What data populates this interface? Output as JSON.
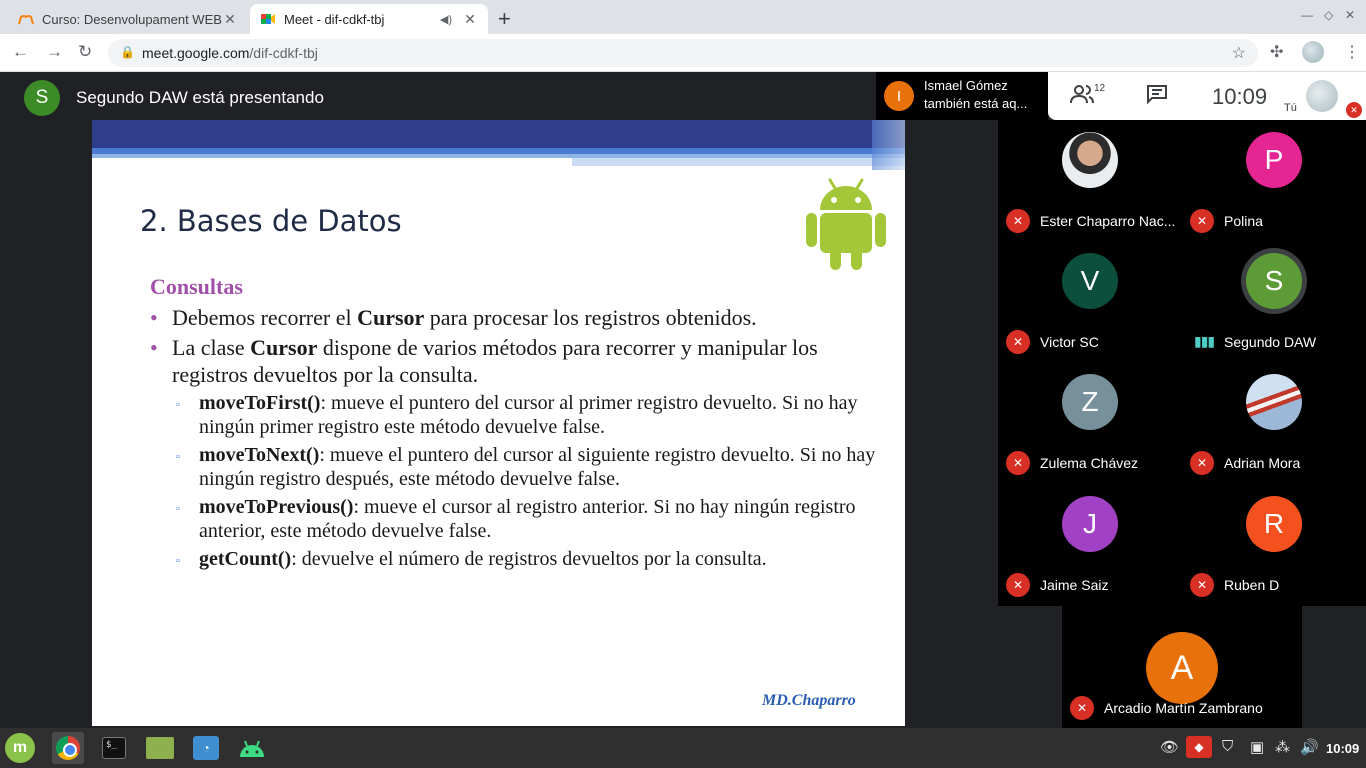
{
  "browser": {
    "tabs": [
      {
        "title": "Curso: Desenvolupament WEB",
        "active": false
      },
      {
        "title": "Meet - dif-cdkf-tbj",
        "active": true
      }
    ],
    "url_host": "meet.google.com",
    "url_path": "/dif-cdkf-tbj"
  },
  "meet": {
    "presenter_initial": "S",
    "presenting_text": "Segundo DAW está presentando",
    "join_toast": {
      "initial": "I",
      "line1": "Ismael Gómez",
      "line2": "también está aq..."
    },
    "people_count": "12",
    "clock": "10:09",
    "self_label": "Tú"
  },
  "slide": {
    "title": "2. Bases de Datos",
    "subtitle": "Consultas",
    "bullet1_pre": "Debemos recorrer el ",
    "bullet1_bold": "Cursor",
    "bullet1_post": " para procesar los registros obtenidos.",
    "bullet2_pre": "La clase ",
    "bullet2_bold": "Cursor",
    "bullet2_post": " dispone de varios métodos para recorrer y manipular los registros devueltos por la consulta.",
    "methods": [
      {
        "name": "moveToFirst()",
        "desc": ": mueve el puntero del cursor al primer registro devuelto. Si no hay ningún primer registro este método devuelve false."
      },
      {
        "name": "moveToNext()",
        "desc": ": mueve el puntero del cursor al siguiente registro devuelto. Si no hay ningún registro después, este método devuelve false."
      },
      {
        "name": "moveToPrevious()",
        "desc": ": mueve el cursor al registro anterior. Si no hay ningún registro anterior, este método devuelve false."
      },
      {
        "name": "getCount()",
        "desc": ": devuelve el número de registros devueltos por la consulta."
      }
    ],
    "signature": "MD.Chaparro"
  },
  "participants": [
    {
      "name": "Ester Chaparro Nac...",
      "initial": "",
      "color": "",
      "muted": true
    },
    {
      "name": "Polina",
      "initial": "P",
      "color": "#e52592",
      "muted": true
    },
    {
      "name": "Victor SC",
      "initial": "V",
      "color": "#0b4f3c",
      "muted": true
    },
    {
      "name": "Segundo DAW",
      "initial": "S",
      "color": "#5d9b37",
      "muted": false
    },
    {
      "name": "Zulema Chávez",
      "initial": "Z",
      "color": "#78909c",
      "muted": true
    },
    {
      "name": "Adrian Mora",
      "initial": "",
      "color": "",
      "muted": true
    },
    {
      "name": "Jaime Saiz",
      "initial": "J",
      "color": "#a142c4",
      "muted": true
    },
    {
      "name": "Ruben D",
      "initial": "R",
      "color": "#f4511e",
      "muted": true
    },
    {
      "name": "Arcadio Martín Zambrano",
      "initial": "A",
      "color": "#e8710a",
      "muted": true
    }
  ],
  "taskbar": {
    "terminal_prompt": "$_",
    "clock": "10:09"
  },
  "colors": {
    "mic_off": "#d93025",
    "slide_accent": "#a050a8",
    "slide_band": "#2f3e8a"
  }
}
